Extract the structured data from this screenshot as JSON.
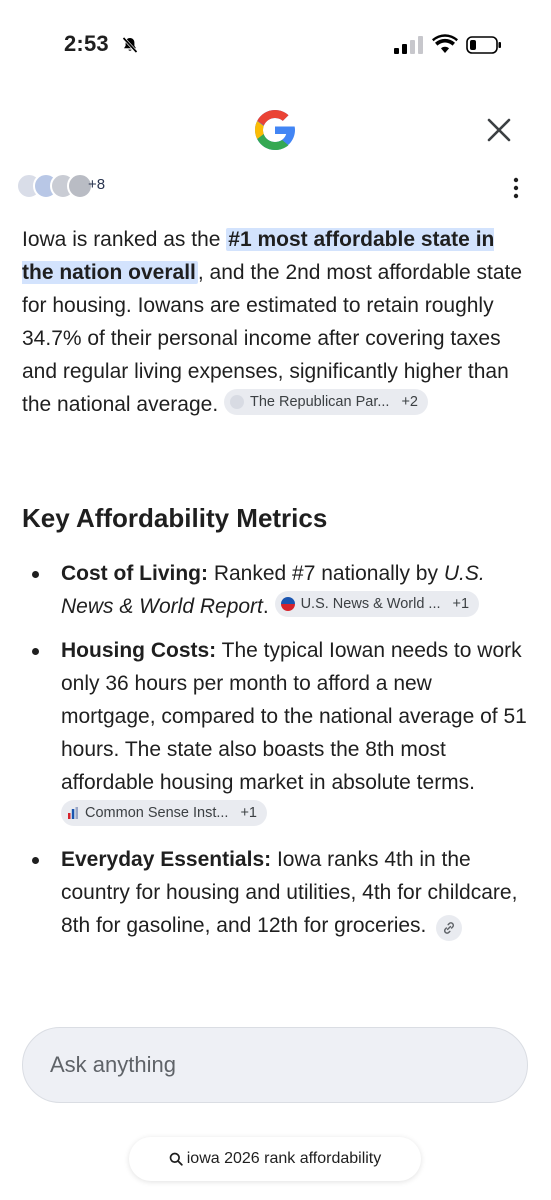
{
  "status_bar": {
    "time": "2:53"
  },
  "sources": {
    "more_count": "+8"
  },
  "answer": {
    "text_before": "Iowa is ranked as the ",
    "highlight": "#1 most affordable state in the nation overall",
    "text_after": ", and the 2nd most affordable state for housing. Iowans are estimated to retain roughly 34.7% of their personal income after covering taxes and regular living expenses, significantly higher than the national average.",
    "citation": {
      "label": "The Republican Par...",
      "count": "+2"
    }
  },
  "section": {
    "heading": "Key Affordability Metrics",
    "items": [
      {
        "title": "Cost of Living:",
        "text": " Ranked #7 nationally by ",
        "italic": "U.S. News & World Report",
        "text_end": ".",
        "citation": {
          "label": "U.S. News & World ...",
          "count": "+1"
        }
      },
      {
        "title": "Housing Costs:",
        "text": " The typical Iowan needs to work only 36 hours per month to afford a new mortgage, compared to the national average of 51 hours. The state also boasts the 8th most affordable housing market in absolute terms.",
        "citation": {
          "label": "Common Sense Inst...",
          "count": "+1"
        }
      },
      {
        "title": "Everyday Essentials:",
        "text": " Iowa ranks 4th in the country for housing and utilities, 4th for childcare, 8th for gasoline, and 12th for groceries."
      }
    ]
  },
  "input": {
    "placeholder": "Ask anything"
  },
  "suggestion": {
    "label": "iowa 2026 rank affordability"
  },
  "colors": {
    "highlight": "#d3e3fd",
    "chip_bg": "#e9ebf0",
    "input_bg": "#eef0f5"
  }
}
